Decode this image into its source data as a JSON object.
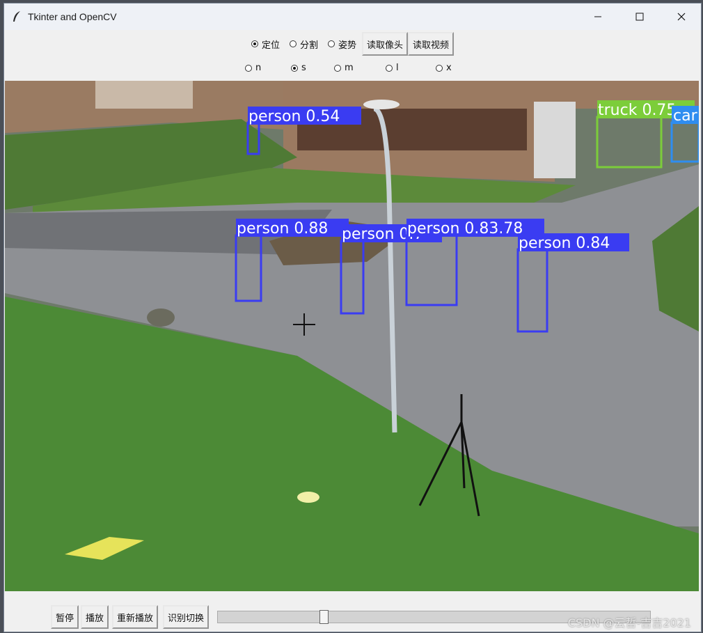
{
  "window": {
    "title": "Tkinter and OpenCV"
  },
  "colors": {
    "person_box": "#3a3cf2",
    "truck_box": "#7ccd3a",
    "car_box": "#2f8df0"
  },
  "mode_options": [
    {
      "label": "定位",
      "selected": true
    },
    {
      "label": "分割",
      "selected": false
    },
    {
      "label": "姿势",
      "selected": false
    }
  ],
  "source_buttons": {
    "camera": "读取像头",
    "video": "读取视频"
  },
  "size_options": [
    {
      "label": "n",
      "selected": false
    },
    {
      "label": "s",
      "selected": true
    },
    {
      "label": "m",
      "selected": false
    },
    {
      "label": "l",
      "selected": false
    },
    {
      "label": "x",
      "selected": false
    }
  ],
  "detections": [
    {
      "label": "person 0.54",
      "class": "person"
    },
    {
      "label": "person 0.88",
      "class": "person"
    },
    {
      "label": "person 0.7",
      "class": "person"
    },
    {
      "label": "person 0.83.78",
      "class": "person"
    },
    {
      "label": "person 0.84",
      "class": "person"
    },
    {
      "label": "truck 0.75",
      "class": "truck"
    },
    {
      "label": "car",
      "class": "car"
    }
  ],
  "playback": {
    "pause": "暂停",
    "play": "播放",
    "replay": "重新播放",
    "switch": "识别切换",
    "progress": 0.24
  },
  "watermark": "CSDN @云哲-吉吉2021"
}
